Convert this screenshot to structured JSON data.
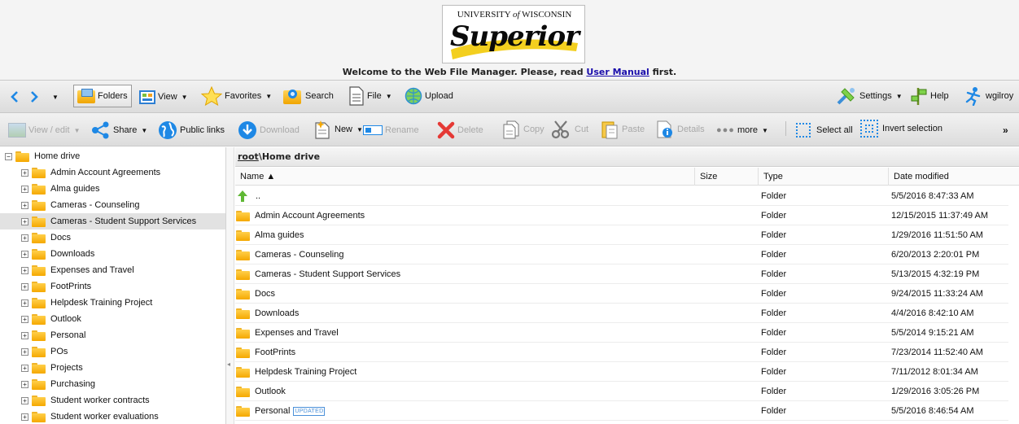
{
  "banner": {
    "logo_top": "UNIVERSITY",
    "logo_of": "of",
    "logo_top2": "WISCONSIN",
    "logo_script": "Superior",
    "welcome_prefix": "Welcome to the Web File Manager. Please, read ",
    "welcome_link": "User Manual",
    "welcome_suffix": " first."
  },
  "toolbar1": {
    "folders": "Folders",
    "view": "View",
    "favorites": "Favorites",
    "search": "Search",
    "file": "File",
    "upload": "Upload",
    "settings": "Settings",
    "help": "Help",
    "user": "wgilroy"
  },
  "toolbar2": {
    "view_edit": "View / edit",
    "share": "Share",
    "public_links": "Public links",
    "download": "Download",
    "new": "New",
    "rename": "Rename",
    "delete": "Delete",
    "copy": "Copy",
    "cut": "Cut",
    "paste": "Paste",
    "details": "Details",
    "more": "more",
    "select_all": "Select all",
    "invert_selection": "Invert selection",
    "overflow": "»"
  },
  "tree": {
    "root": "Home drive",
    "items": [
      "Admin Account Agreements",
      "Alma guides",
      "Cameras - Counseling",
      "Cameras - Student Support Services",
      "Docs",
      "Downloads",
      "Expenses and Travel",
      "FootPrints",
      "Helpdesk Training Project",
      "Outlook",
      "Personal",
      "POs",
      "Projects",
      "Purchasing",
      "Student worker contracts",
      "Student worker evaluations"
    ],
    "selected_index": 3
  },
  "breadcrumb": {
    "root": "root",
    "separator": "\\",
    "current": "Home drive"
  },
  "grid": {
    "columns": {
      "name": "Name ▲",
      "size": "Size",
      "type": "Type",
      "date": "Date modified"
    },
    "rows": [
      {
        "name": "..",
        "type": "Folder",
        "date": "5/5/2016 8:47:33 AM",
        "icon": "up-arrow-icon"
      },
      {
        "name": "Admin Account Agreements",
        "type": "Folder",
        "date": "12/15/2015 11:37:49 AM",
        "icon": "folder-icon"
      },
      {
        "name": "Alma guides",
        "type": "Folder",
        "date": "1/29/2016 11:51:50 AM",
        "icon": "folder-icon"
      },
      {
        "name": "Cameras - Counseling",
        "type": "Folder",
        "date": "6/20/2013 2:20:01 PM",
        "icon": "folder-icon"
      },
      {
        "name": "Cameras - Student Support Services",
        "type": "Folder",
        "date": "5/13/2015 4:32:19 PM",
        "icon": "folder-icon"
      },
      {
        "name": "Docs",
        "type": "Folder",
        "date": "9/24/2015 11:33:24 AM",
        "icon": "folder-icon"
      },
      {
        "name": "Downloads",
        "type": "Folder",
        "date": "4/4/2016 8:42:10 AM",
        "icon": "folder-icon"
      },
      {
        "name": "Expenses and Travel",
        "type": "Folder",
        "date": "5/5/2014 9:15:21 AM",
        "icon": "folder-icon"
      },
      {
        "name": "FootPrints",
        "type": "Folder",
        "date": "7/23/2014 11:52:40 AM",
        "icon": "folder-icon"
      },
      {
        "name": "Helpdesk Training Project",
        "type": "Folder",
        "date": "7/11/2012 8:01:34 AM",
        "icon": "folder-icon"
      },
      {
        "name": "Outlook",
        "type": "Folder",
        "date": "1/29/2016 3:05:26 PM",
        "icon": "folder-icon"
      },
      {
        "name": "Personal",
        "type": "Folder",
        "date": "5/5/2016 8:46:54 AM",
        "icon": "folder-icon",
        "badge": "UPDATED"
      }
    ]
  },
  "colors": {
    "accent_blue": "#1e88e5",
    "folder_yellow": "#f5a800",
    "logo_yellow": "#f3cf1f",
    "link": "#1a0dab"
  }
}
